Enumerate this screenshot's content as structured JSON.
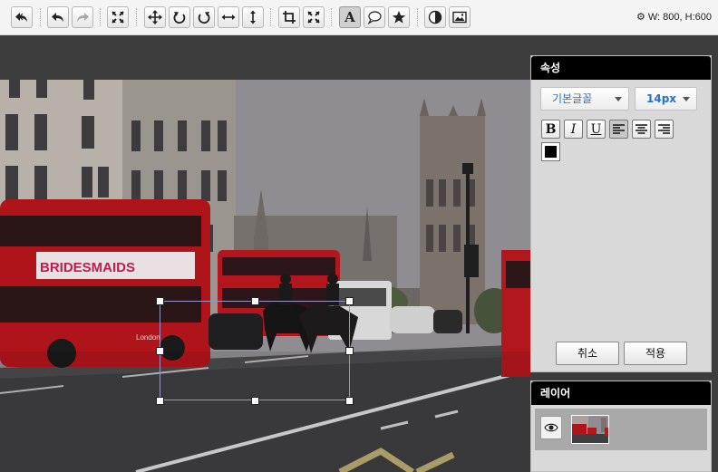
{
  "toolbar": {
    "buttons": [
      {
        "name": "undo-all",
        "icon": "undo-all-icon"
      },
      {
        "name": "undo",
        "icon": "undo-icon"
      },
      {
        "name": "redo",
        "icon": "redo-icon"
      },
      {
        "name": "fit",
        "icon": "fit-icon"
      },
      {
        "name": "move",
        "icon": "move-icon"
      },
      {
        "name": "rotate-left",
        "icon": "rotate-left-icon"
      },
      {
        "name": "rotate-right",
        "icon": "rotate-right-icon"
      },
      {
        "name": "flip-horizontal",
        "icon": "flip-horizontal-icon"
      },
      {
        "name": "flip-vertical",
        "icon": "flip-vertical-icon"
      },
      {
        "name": "crop",
        "icon": "crop-icon"
      },
      {
        "name": "resize",
        "icon": "resize-icon"
      },
      {
        "name": "text",
        "icon": "text-icon"
      },
      {
        "name": "speech-bubble",
        "icon": "speech-bubble-icon"
      },
      {
        "name": "sticker",
        "icon": "star-icon"
      },
      {
        "name": "filter",
        "icon": "contrast-icon"
      },
      {
        "name": "insert-image",
        "icon": "image-icon"
      }
    ],
    "text_button_label": "A",
    "size_info": "W: 800, H:600"
  },
  "properties": {
    "title": "속성",
    "font_family": "기본글꼴",
    "font_size": "14px",
    "bold_label": "B",
    "italic_label": "I",
    "underline_label": "U",
    "text_color": "#000000",
    "cancel_label": "취소",
    "apply_label": "적용"
  },
  "layers": {
    "title": "레이어",
    "items": [
      {
        "visible": true,
        "thumbnail": "photo-thumbnail"
      }
    ]
  },
  "colors": {
    "toolbar_bg": "#f4f4f4",
    "workspace_bg": "#3d3d3d",
    "panel_bg": "#d9d9d9",
    "panel_header": "#000000",
    "select_text": "#2a6fc9",
    "selection_border": "#9a95c8"
  },
  "photo": {
    "bus_ad_text": "BRIDESMAIDS",
    "bus_route_text": "London"
  }
}
